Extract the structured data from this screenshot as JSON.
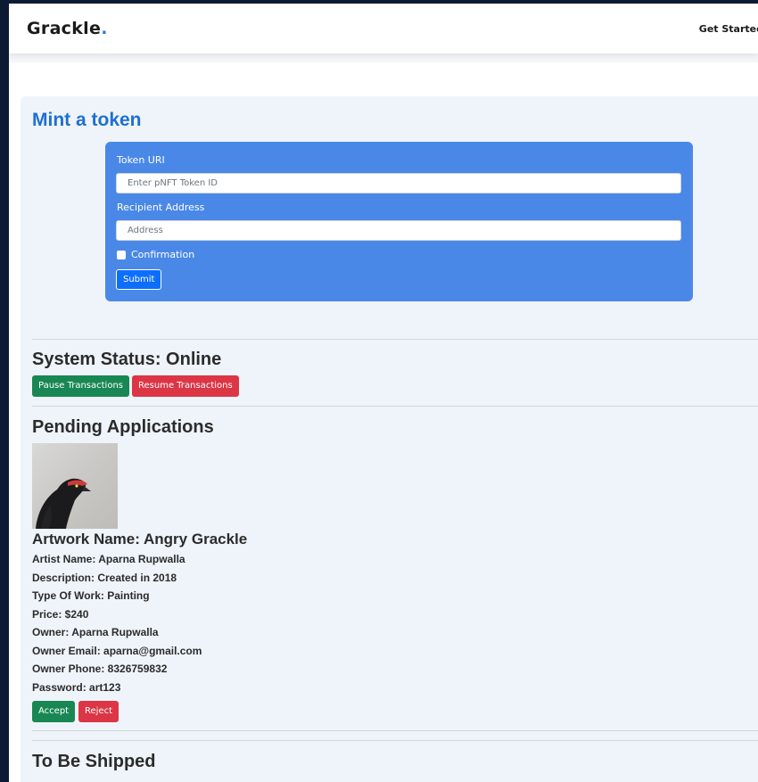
{
  "navbar": {
    "brand": "Grackle",
    "brand_dot": ".",
    "get_started": "Get Started"
  },
  "mint": {
    "title": "Mint a token",
    "token_uri_label": "Token URI",
    "token_uri_placeholder": "Enter pNFT Token ID",
    "recipient_label": "Recipient Address",
    "recipient_placeholder": "Address",
    "confirmation_label": "Confirmation",
    "submit_label": "Submit"
  },
  "system_status": {
    "title": "System Status: Online",
    "pause_label": "Pause Transactions",
    "resume_label": "Resume Transactions"
  },
  "pending": {
    "title": "Pending Applications",
    "artwork_title": "Artwork Name: Angry Grackle",
    "lines": [
      "Artist Name: Aparna Rupwalla",
      "Description: Created in 2018",
      "Type Of Work: Painting",
      "Price: $240",
      "Owner: Aparna Rupwalla",
      "Owner Email: aparna@gmail.com",
      "Owner Phone: 8326759832",
      "Password: art123"
    ],
    "accept_label": "Accept",
    "reject_label": "Reject"
  },
  "shipped": {
    "title": "To Be Shipped"
  },
  "colors": {
    "brand_accent": "#2a7de1",
    "form_card": "#4a88e8",
    "primary": "#0d6efd",
    "success": "#198754",
    "danger": "#dc3545"
  }
}
